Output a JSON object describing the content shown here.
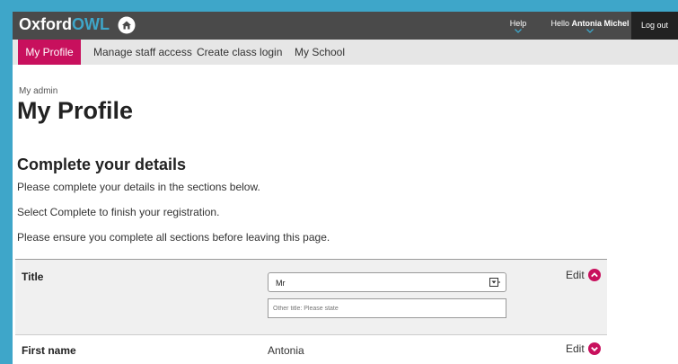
{
  "header": {
    "logo_oxford": "Oxford",
    "logo_owl": "OWL",
    "help": "Help",
    "hello_prefix": "Hello ",
    "hello_name": "Antonia Michel",
    "logout": "Log out"
  },
  "nav": {
    "items": [
      {
        "label": "My Profile",
        "active": true
      },
      {
        "label": "Manage staff access"
      },
      {
        "label": "Create class login"
      },
      {
        "label": "My School"
      }
    ]
  },
  "page": {
    "breadcrumb": "My admin",
    "title": "My Profile",
    "section_heading": "Complete your details",
    "intro_1": "Please complete your details in the sections below.",
    "intro_2": "Select Complete to finish your registration.",
    "intro_3": "Please ensure you complete all sections before leaving this page."
  },
  "form": {
    "title_row": {
      "label": "Title",
      "select_value": "Mr",
      "other_placeholder": "Other title: Please state",
      "edit_label": "Edit"
    },
    "first_name_row": {
      "label": "First name",
      "value": "Antonia",
      "edit_label": "Edit"
    }
  },
  "colors": {
    "accent": "#c8105d",
    "frame_border": "#3ea6c9",
    "topbar": "#4a4a4a",
    "navbar": "#e6e6e6"
  },
  "icons": [
    "home-icon",
    "chevron-down-icon",
    "dropdown-arrow-icon",
    "chevron-up-circle-icon",
    "chevron-down-circle-icon"
  ]
}
